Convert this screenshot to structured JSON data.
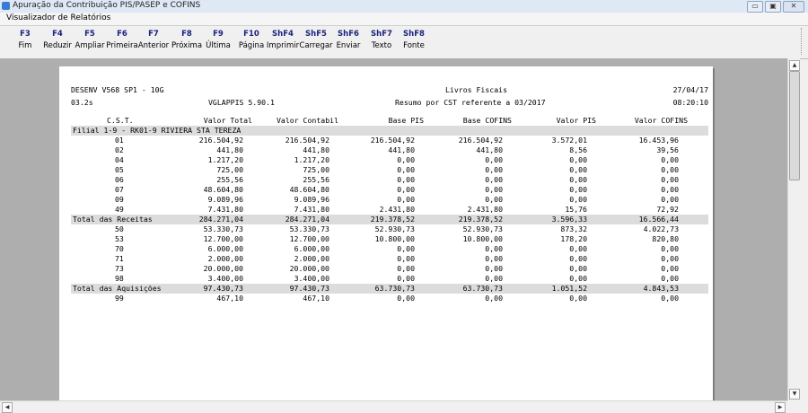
{
  "window": {
    "title": "Apuração da Contribuição PIS/PASEP e COFINS",
    "minimize": "▭",
    "restore": "▣",
    "close": "✕"
  },
  "menu": {
    "title": "Visualizador de Relatórios"
  },
  "toolbar": [
    {
      "key": "F3",
      "label": "Fim"
    },
    {
      "key": "F4",
      "label": "Reduzir"
    },
    {
      "key": "F5",
      "label": "Ampliar"
    },
    {
      "key": "F6",
      "label": "Primeira"
    },
    {
      "key": "F7",
      "label": "Anterior"
    },
    {
      "key": "F8",
      "label": "Próxima"
    },
    {
      "key": "F9",
      "label": "Última"
    },
    {
      "key": "F10",
      "label": "Página"
    },
    {
      "key": "ShF4",
      "label": "Imprimir"
    },
    {
      "key": "ShF5",
      "label": "Carregar"
    },
    {
      "key": "ShF6",
      "label": "Enviar"
    },
    {
      "key": "ShF7",
      "label": "Texto"
    },
    {
      "key": "ShF8",
      "label": "Fonte"
    }
  ],
  "report": {
    "header_left_1": "DESENV V568 SP1 - 10G",
    "header_center_1": "Livros Fiscais",
    "header_right_1": "27/04/17",
    "header_left_2": "03.2s",
    "header_mid_2": "VGLAPPIS 5.90.1",
    "header_center_2": "Resumo por CST referente a 03/2017",
    "header_right_2": "08:20:10",
    "columns": [
      "C.S.T.",
      "Valor Total",
      "Valor Contabil",
      "Base PIS",
      "Base COFINS",
      "Valor PIS",
      "Valor COFINS"
    ],
    "filial_label": "Filial 1-9 - RK01-9 RIVIERA STA TEREZA",
    "rows": [
      {
        "type": "data",
        "cst": "01",
        "values": [
          "216.504,92",
          "216.504,92",
          "216.504,92",
          "216.504,92",
          "3.572,01",
          "16.453,96"
        ]
      },
      {
        "type": "data",
        "cst": "02",
        "values": [
          "441,80",
          "441,80",
          "441,80",
          "441,80",
          "8,56",
          "39,56"
        ]
      },
      {
        "type": "data",
        "cst": "04",
        "values": [
          "1.217,20",
          "1.217,20",
          "0,00",
          "0,00",
          "0,00",
          "0,00"
        ]
      },
      {
        "type": "data",
        "cst": "05",
        "values": [
          "725,00",
          "725,00",
          "0,00",
          "0,00",
          "0,00",
          "0,00"
        ]
      },
      {
        "type": "data",
        "cst": "06",
        "values": [
          "255,56",
          "255,56",
          "0,00",
          "0,00",
          "0,00",
          "0,00"
        ]
      },
      {
        "type": "data",
        "cst": "07",
        "values": [
          "48.604,80",
          "48.604,80",
          "0,00",
          "0,00",
          "0,00",
          "0,00"
        ]
      },
      {
        "type": "data",
        "cst": "09",
        "values": [
          "9.089,96",
          "9.089,96",
          "0,00",
          "0,00",
          "0,00",
          "0,00"
        ]
      },
      {
        "type": "data",
        "cst": "49",
        "values": [
          "7.431,80",
          "7.431,80",
          "2.431,80",
          "2.431,80",
          "15,76",
          "72,92"
        ]
      },
      {
        "type": "total",
        "cst": "Total das Receitas",
        "values": [
          "284.271,04",
          "284.271,04",
          "219.378,52",
          "219.378,52",
          "3.596,33",
          "16.566,44"
        ]
      },
      {
        "type": "data",
        "cst": "50",
        "values": [
          "53.330,73",
          "53.330,73",
          "52.930,73",
          "52.930,73",
          "873,32",
          "4.022,73"
        ]
      },
      {
        "type": "data",
        "cst": "53",
        "values": [
          "12.700,00",
          "12.700,00",
          "10.800,00",
          "10.800,00",
          "178,20",
          "820,80"
        ]
      },
      {
        "type": "data",
        "cst": "70",
        "values": [
          "6.000,00",
          "6.000,00",
          "0,00",
          "0,00",
          "0,00",
          "0,00"
        ]
      },
      {
        "type": "data",
        "cst": "71",
        "values": [
          "2.000,00",
          "2.000,00",
          "0,00",
          "0,00",
          "0,00",
          "0,00"
        ]
      },
      {
        "type": "data",
        "cst": "73",
        "values": [
          "20.000,00",
          "20.000,00",
          "0,00",
          "0,00",
          "0,00",
          "0,00"
        ]
      },
      {
        "type": "data",
        "cst": "98",
        "values": [
          "3.400,00",
          "3.400,00",
          "0,00",
          "0,00",
          "0,00",
          "0,00"
        ]
      },
      {
        "type": "total",
        "cst": "Total das Aquisições",
        "values": [
          "97.430,73",
          "97.430,73",
          "63.730,73",
          "63.730,73",
          "1.051,52",
          "4.843,53"
        ]
      },
      {
        "type": "data",
        "cst": "99",
        "values": [
          "467,10",
          "467,10",
          "0,00",
          "0,00",
          "0,00",
          "0,00"
        ]
      }
    ]
  },
  "scroll": {
    "up": "▲",
    "down": "▼",
    "left": "◀",
    "right": "▶"
  }
}
